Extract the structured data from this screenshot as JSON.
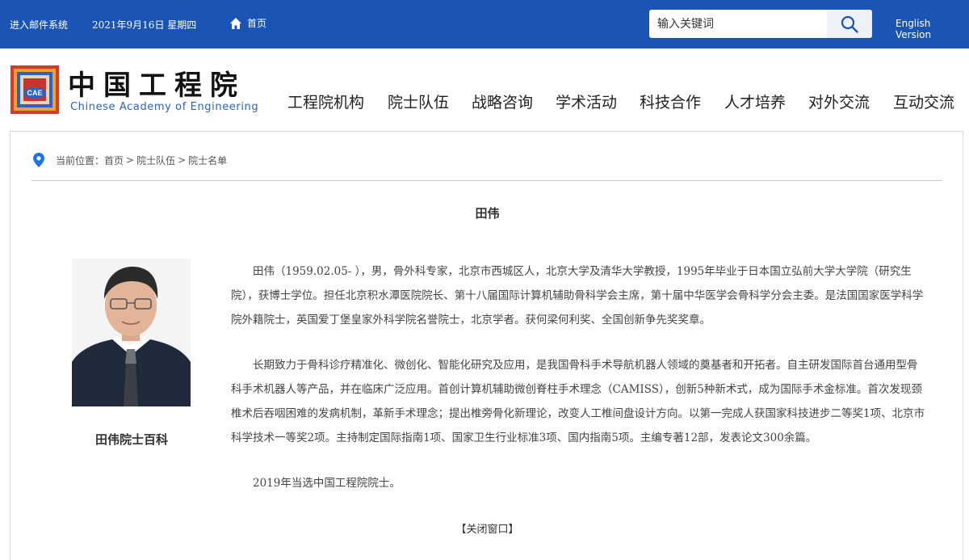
{
  "topbar": {
    "mail": "进入邮件系统",
    "date": "2021年9月16日  星期四",
    "home": "首页",
    "search_placeholder": "输入关键词",
    "english": "English Version"
  },
  "header": {
    "logo_cn": "中国工程院",
    "logo_en": "Chinese Academy of Engineering",
    "logo_badge": "CAE",
    "nav": [
      "工程院机构",
      "院士队伍",
      "战略咨询",
      "学术活动",
      "科技合作",
      "人才培养",
      "对外交流",
      "互动交流"
    ]
  },
  "breadcrumb": {
    "prefix": "当前位置：",
    "items": [
      "首页",
      "院士队伍",
      "院士名单"
    ],
    "separator": ">"
  },
  "profile": {
    "name": "田伟",
    "caption": "田伟院士百科",
    "paragraphs": [
      "田伟（1959.02.05- ），男，骨外科专家，北京市西城区人，北京大学及清华大学教授，1995年毕业于日本国立弘前大学大学院（研究生院），获博士学位。担任北京积水潭医院院长、第十八届国际计算机辅助骨科学会主席，第十届中华医学会骨科学分会主委。是法国国家医学科学院外籍院士，英国爱丁堡皇家外科学院名誉院士，北京学者。获何梁何利奖、全国创新争先奖奖章。",
      "长期致力于骨科诊疗精准化、微创化、智能化研究及应用，是我国骨科手术导航机器人领域的奠基者和开拓者。自主研发国际首台通用型骨科手术机器人等产品，并在临床广泛应用。首创计算机辅助微创脊柱手术理念（CAMISS），创新5种新术式，成为国际手术金标准。首次发现颈椎术后吞咽困难的发病机制，革新手术理念；提出椎旁骨化新理论，改变人工椎间盘设计方向。以第一完成人获国家科技进步二等奖1项、北京市科学技术一等奖2项。主持制定国际指南1项、国家卫生行业标准3项、国内指南5项。主编专著12部，发表论文300余篇。",
      "2019年当选中国工程院院士。"
    ]
  },
  "close_label": "【关闭窗口】",
  "colors": {
    "topbar": "#1a55b5",
    "logo_blue": "#2a62c9",
    "accent_pin": "#1a73e8"
  }
}
